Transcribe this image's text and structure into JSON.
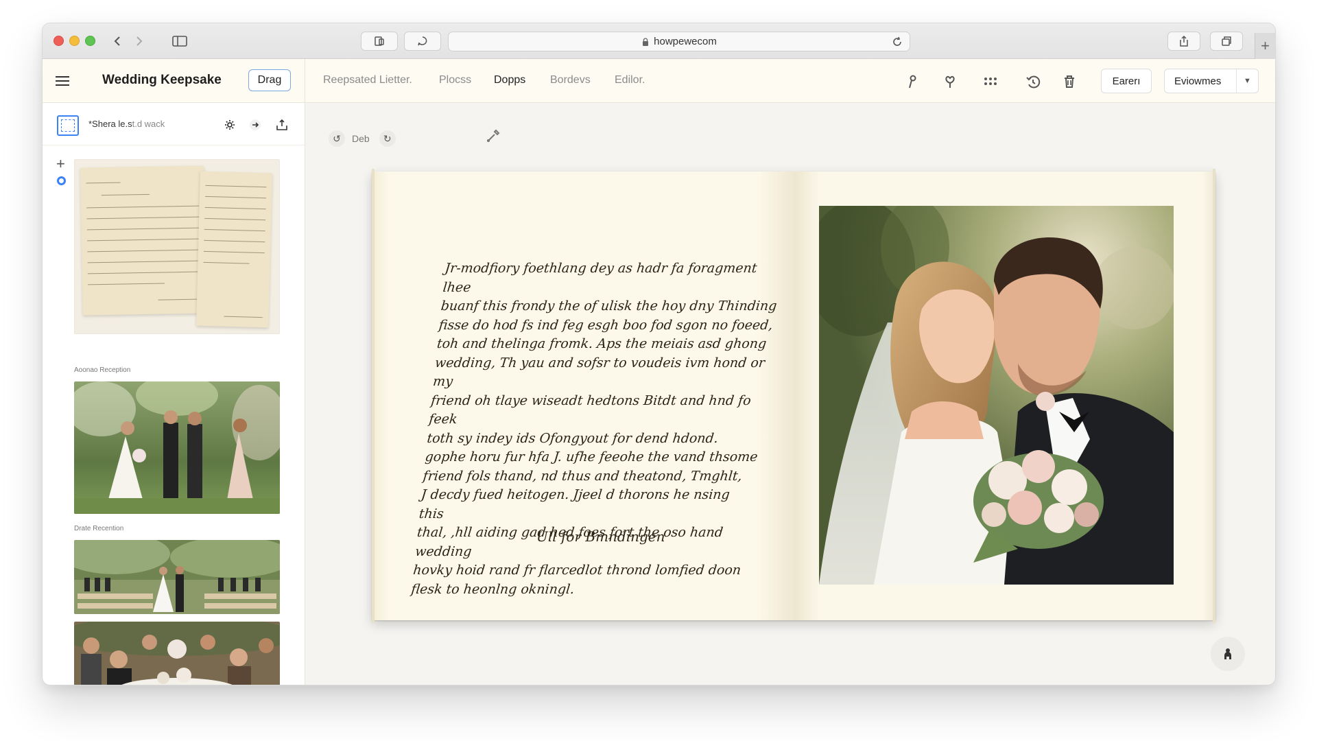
{
  "browser": {
    "url": "howpewecom"
  },
  "app": {
    "title": "Wedding Keepsake",
    "drag_label": "Drag",
    "menu": [
      "Reepsated Lietter.",
      "Plocss",
      "Dopps",
      "Bordevs",
      "Edilor."
    ],
    "active_menu": "Dopps",
    "export_label": "Earerı",
    "dropdown_label": "Eviowmes"
  },
  "sidebar": {
    "title_main": "*Shera le.s",
    "title_faded": "t.d wack",
    "captions": [
      "Aoonao Reception",
      "Drate Recention"
    ]
  },
  "canvas": {
    "tool_label": "Deb",
    "letter_lines": [
      "Jr-modfiory foethlang dey as hadr fa foragment lhee",
      "buanf this frondy the of ulisk the hoy dny Thinding",
      "fisse do hod fs ind feg esgh boo fod sgon no foeed,",
      "toh and thelinga fromk.   Aps the meiais asd ghong",
      "wedding, Th yau and sofsr to voudeis ivm hond or my",
      "friend oh tlaye wiseadt hedtons Bitdt and hnd fo feek",
      "toth sy indey ids Ofongyout for dend hdond.",
      "gophe horu fur hfa J. ufhe feeohe the vand thsome",
      "friend fols thand, nd thus and theatond, Tmghlt,",
      "J decdy fued heitogen. Jjeel d thorons he nsing this",
      "thal, ,hll aiding gad hed foes fort the oso hand wedding",
      "hovky hoid rand fr flarcedlot thrond lomfied doon",
      "flesk to heonlng okningl."
    ],
    "signature": "Ull for Bmndingen"
  },
  "colors": {
    "accent": "#3b82f6",
    "paper": "#fbf6e6",
    "ink": "#2b2419"
  }
}
